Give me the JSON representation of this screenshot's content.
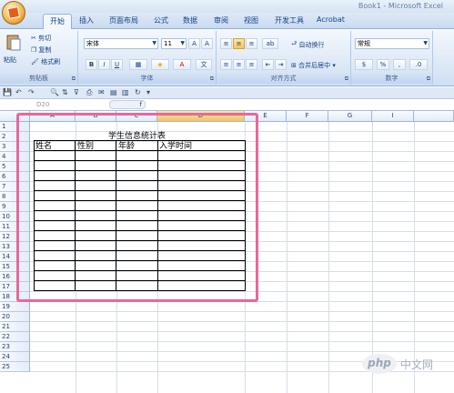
{
  "window": {
    "title": "Book1 - Microsoft Excel"
  },
  "tabs": [
    "开始",
    "插入",
    "页面布局",
    "公式",
    "数据",
    "审阅",
    "视图",
    "开发工具",
    "Acrobat"
  ],
  "ribbon": {
    "clipboard": {
      "paste": "粘贴",
      "cut": "剪切",
      "copy": "复制",
      "format_painter": "格式刷",
      "label": "剪贴板"
    },
    "font": {
      "name": "宋体",
      "size": "11",
      "bold": "B",
      "italic": "I",
      "underline": "U",
      "label": "字体"
    },
    "alignment": {
      "wrap": "自动换行",
      "merge": "合并后居中",
      "label": "对齐方式"
    },
    "number": {
      "format": "常规",
      "percent": "%",
      "label": "数字"
    }
  },
  "formula_bar": {
    "name_box": "D20",
    "fx": "f"
  },
  "sheet": {
    "columns": [
      "A",
      "B",
      "C",
      "D",
      "E",
      "F",
      "G",
      "I"
    ],
    "selected_column": "D",
    "rows": [
      "1",
      "2",
      "3",
      "4",
      "5",
      "6",
      "7",
      "8",
      "9",
      "10",
      "11",
      "12",
      "13",
      "14",
      "15",
      "16",
      "17",
      "18",
      "19",
      "20",
      "21",
      "22",
      "23",
      "24",
      "25"
    ],
    "table_title": "学生信息统计表",
    "headers": [
      "姓名",
      "性别",
      "年龄",
      "入学时间"
    ]
  },
  "watermark": {
    "logo": "php",
    "text": "中文网"
  },
  "colors": {
    "highlight": "#e9679a",
    "ribbon": "#dbe7f6",
    "selected_header": "#f5c462"
  }
}
